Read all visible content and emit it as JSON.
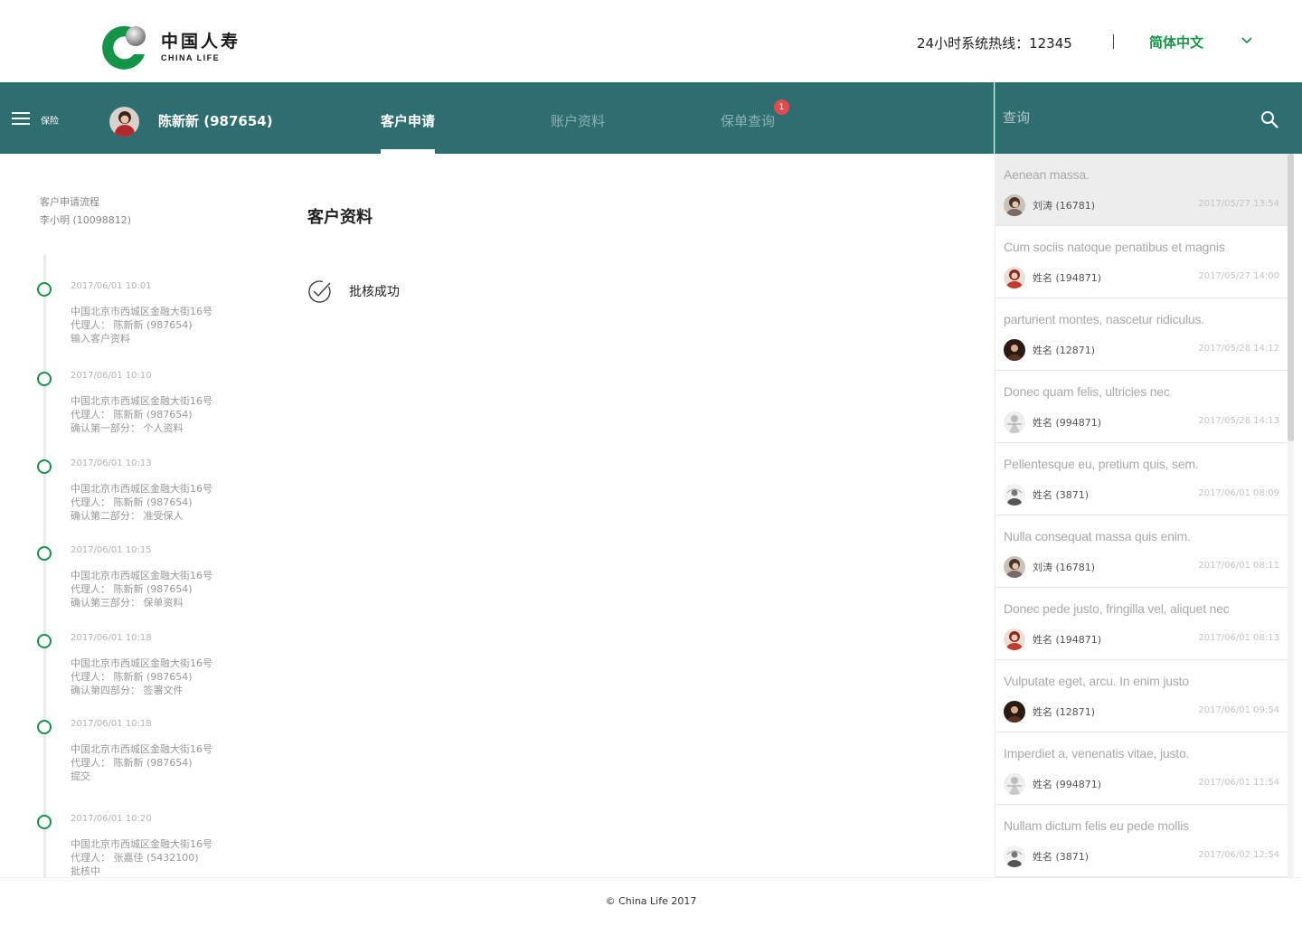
{
  "brand": {
    "name_cn": "中国人寿",
    "name_en": "CHINA LIFE",
    "colors": {
      "green": "#149447",
      "nav": "#2f6e70",
      "badge": "#e14b4b"
    }
  },
  "header": {
    "hotline": "24小时系统热线：12345",
    "language": "简体中文"
  },
  "nav": {
    "menu_label": "保险",
    "user": "陈新新 (987654)",
    "tabs": [
      {
        "label": "客户申请",
        "active": true
      },
      {
        "label": "账户资料",
        "active": false
      },
      {
        "label": "保单查询",
        "active": false,
        "badge": "1"
      }
    ]
  },
  "search": {
    "placeholder": "查询"
  },
  "flow": {
    "title": "客户申请流程",
    "client": "李小明 (10098812)",
    "steps": [
      {
        "time": "2017/06/01   10:01",
        "address": "中国北京市西城区金融大街16号",
        "agent": "代理人：  陈新新  (987654)",
        "action": "输入客户资料"
      },
      {
        "time": "2017/06/01   10:10",
        "address": "中国北京市西城区金融大街16号",
        "agent": "代理人：  陈新新  (987654)",
        "action": "确认第一部分：  个人资料"
      },
      {
        "time": "2017/06/01   10:13",
        "address": "中国北京市西城区金融大街16号",
        "agent": "代理人：  陈新新  (987654)",
        "action": "确认第二部分：  准受保人"
      },
      {
        "time": "2017/06/01   10:15",
        "address": "中国北京市西城区金融大街16号",
        "agent": "代理人：  陈新新  (987654)",
        "action": "确认第三部分：  保单资料"
      },
      {
        "time": "2017/06/01   10:18",
        "address": "中国北京市西城区金融大街16号",
        "agent": "代理人：  陈新新  (987654)",
        "action": "确认第四部分：  签署文件"
      },
      {
        "time": "2017/06/01   10:18",
        "address": "中国北京市西城区金融大街16号",
        "agent": "代理人：  陈新新  (987654)",
        "action": "提交"
      },
      {
        "time": "2017/06/01   10:20",
        "address": "中国北京市西城区金融大街16号",
        "agent": "代理人：  张嘉佳  (5432100)",
        "action": "批核中"
      }
    ]
  },
  "main": {
    "section_title": "客户资料",
    "status": "批核成功"
  },
  "messages": [
    {
      "title": "Aenean massa.",
      "name": "刘涛 (16781)",
      "time": "2017/05/27   13:54",
      "avatar": "a"
    },
    {
      "title": "Cum sociis natoque penatibus et magnis",
      "name": "姓名  (194871)",
      "time": "2017/05/27   14:00",
      "avatar": "b"
    },
    {
      "title": "parturient montes, nascetur ridiculus.",
      "name": "姓名  (12871)",
      "time": "2017/05/28   14:12",
      "avatar": "c"
    },
    {
      "title": "Donec quam felis, ultricies nec",
      "name": "姓名 (994871)",
      "time": "2017/05/28   14:13",
      "avatar": "d"
    },
    {
      "title": "Pellentesque eu, pretium quis, sem.",
      "name": "姓名 (3871)",
      "time": "2017/06/01   08:09",
      "avatar": "e"
    },
    {
      "title": "Nulla consequat massa quis enim.",
      "name": "刘涛 (16781)",
      "time": "2017/06/01   08:11",
      "avatar": "a"
    },
    {
      "title": "Donec pede justo, fringilla vel, aliquet nec",
      "name": "姓名  (194871)",
      "time": "2017/06/01   08:13",
      "avatar": "b"
    },
    {
      "title": "Vulputate eget, arcu. In enim justo",
      "name": "姓名  (12871)",
      "time": "2017/06/01   09:54",
      "avatar": "c"
    },
    {
      "title": "Imperdiet a, venenatis vitae, justo.",
      "name": "姓名 (994871)",
      "time": "2017/06/01   11:54",
      "avatar": "d"
    },
    {
      "title": "Nullam dictum felis eu pede mollis",
      "name": "姓名 (3871)",
      "time": "2017/06/02   12:54",
      "avatar": "e"
    }
  ],
  "footer": {
    "copyright": "© China Life 2017"
  }
}
